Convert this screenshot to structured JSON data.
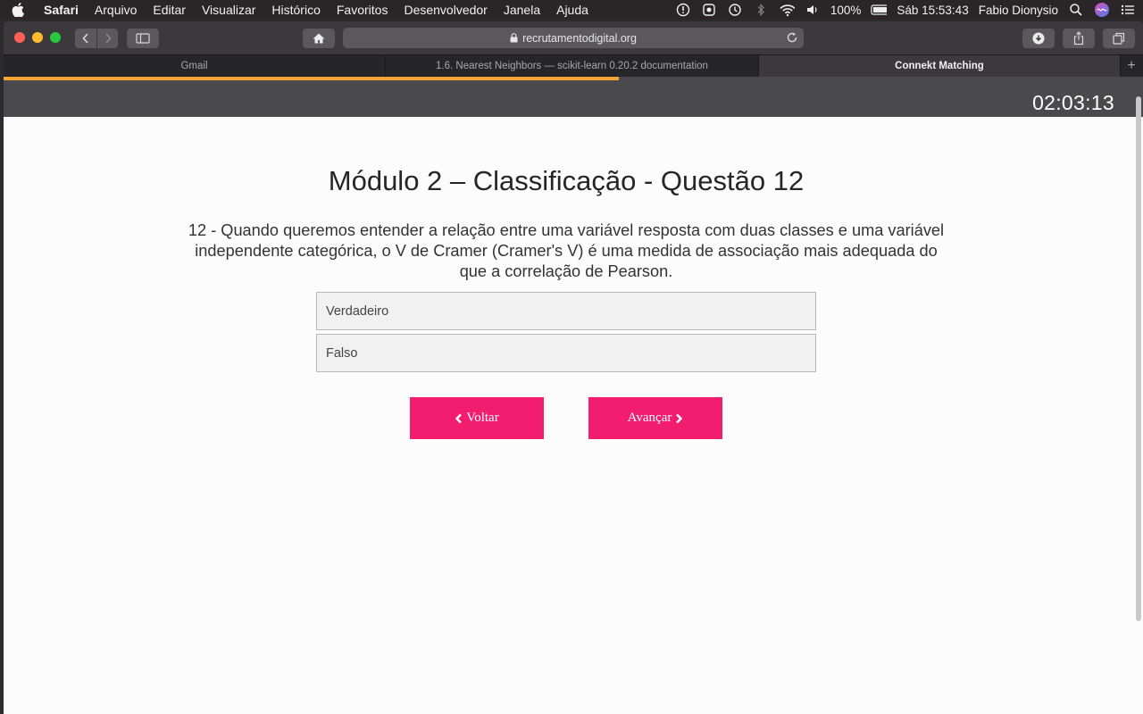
{
  "menubar": {
    "items": [
      "Safari",
      "Arquivo",
      "Editar",
      "Visualizar",
      "Histórico",
      "Favoritos",
      "Desenvolvedor",
      "Janela",
      "Ajuda"
    ],
    "battery": "100%",
    "clock": "Sáb 15:53:43",
    "user": "Fabio Dionysio"
  },
  "browser": {
    "url": "recrutamentodigital.org",
    "tabs": [
      {
        "label": "Gmail"
      },
      {
        "label": "1.6. Nearest Neighbors — scikit-learn 0.20.2 documentation"
      },
      {
        "label": "Connekt Matching"
      }
    ]
  },
  "quiz": {
    "progress": 0.54,
    "timer": "02:03:13",
    "title": "Módulo 2 – Classificação - Questão 12",
    "question": "12 - Quando queremos entender a relação entre uma variável resposta com duas classes e uma variável independente categórica, o V de Cramer (Cramer's V) é uma medida de associação mais adequada do que a correlação de Pearson.",
    "options": [
      "Verdadeiro",
      "Falso"
    ],
    "back_label": "Voltar",
    "next_label": "Avançar"
  },
  "colors": {
    "accent": "#f21d6f",
    "progress": "#f5a531",
    "header": "#4a494b"
  }
}
